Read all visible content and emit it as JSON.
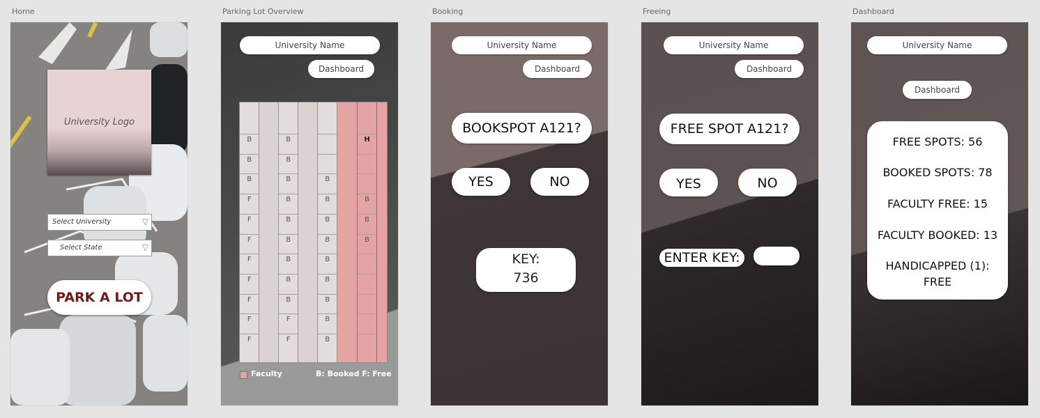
{
  "artboards": {
    "home": "Home",
    "overview": "Parking Lot Overview",
    "booking": "Booking",
    "freeing": "Freeing",
    "dashboard": "Dashboard"
  },
  "header": {
    "university_name": "University Name",
    "dashboard_button": "Dashboard"
  },
  "home": {
    "logo_label": "University Logo",
    "select_university": "Select University",
    "select_state": "Select State",
    "park_button": "PARK A LOT"
  },
  "overview": {
    "columns": [
      {
        "cells": [
          "",
          "B",
          "B",
          "B",
          "F",
          "F",
          "F",
          "F",
          "F",
          "F",
          "F",
          "F"
        ],
        "style": "normal"
      },
      {
        "cells": [],
        "style": "blank"
      },
      {
        "cells": [
          "",
          "B",
          "B",
          "B",
          "B",
          "B",
          "B",
          "B",
          "B",
          "B",
          "F",
          "F"
        ],
        "style": "normal"
      },
      {
        "cells": [],
        "style": "blank"
      },
      {
        "cells": [
          "",
          "",
          "",
          "B",
          "B",
          "B",
          "B",
          "B",
          "B",
          "B",
          "B",
          "B"
        ],
        "style": "normal"
      },
      {
        "cells": [],
        "style": "pink-blank"
      },
      {
        "cells": [
          "",
          "H",
          "",
          "",
          "B",
          "B",
          "B",
          "",
          "",
          "",
          "",
          ""
        ],
        "style": "pink"
      }
    ],
    "legend_faculty": "Faculty",
    "legend_key": "B: Booked F: Free",
    "faculty_color": "#e4a4a4"
  },
  "booking": {
    "question": "BOOKSPOT A121?",
    "yes": "YES",
    "no": "NO",
    "key_label": "KEY:",
    "key_value": "736"
  },
  "freeing": {
    "question": "FREE SPOT A121?",
    "yes": "YES",
    "no": "NO",
    "enter_key": "ENTER KEY:"
  },
  "dashboard": {
    "free_spots": "FREE SPOTS: 56",
    "booked_spots": "BOOKED SPOTS: 78",
    "faculty_free": "FACULTY FREE: 15",
    "faculty_booked": "FACULTY BOOKED: 13",
    "handicapped_label": "HANDICAPPED (1):",
    "handicapped_value": "FREE"
  },
  "icons": {
    "dropdown": "triangle-down-icon"
  }
}
